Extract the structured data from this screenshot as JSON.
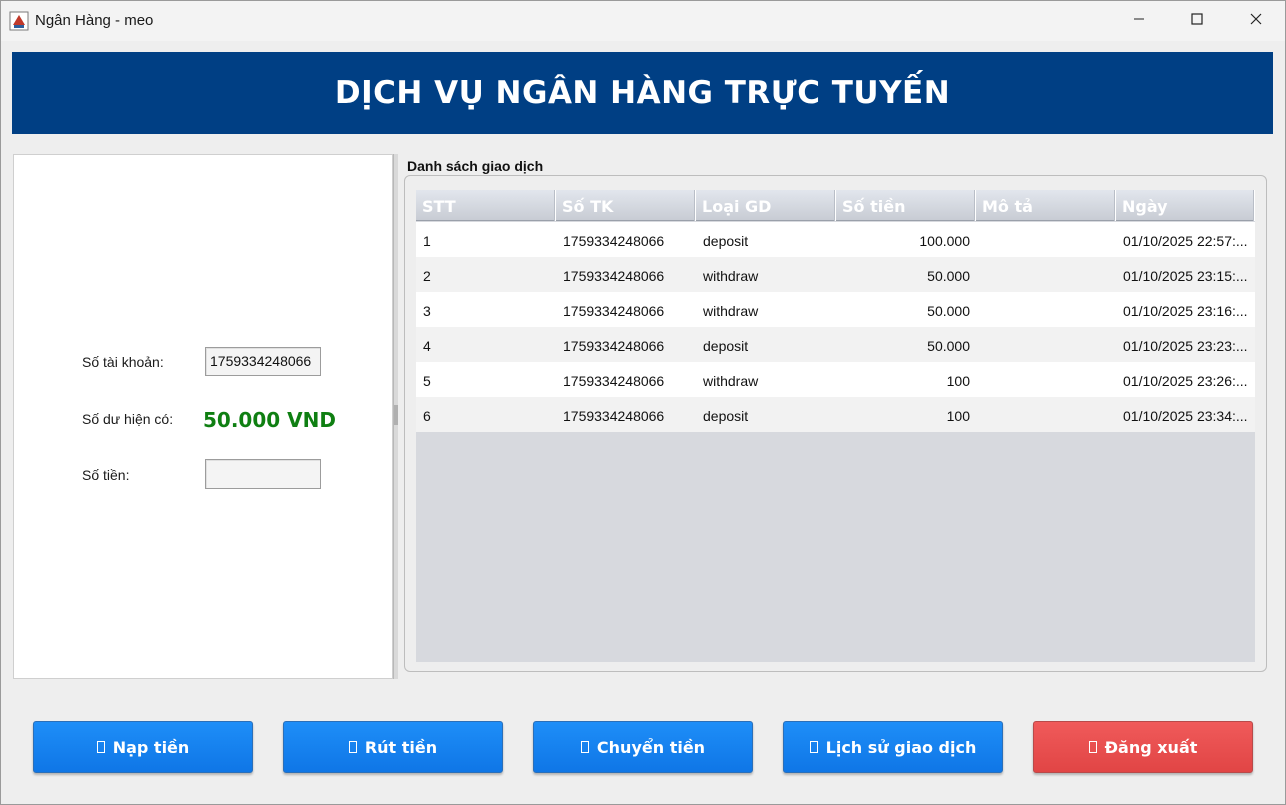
{
  "window": {
    "title": "Ngân Hàng - meo",
    "app_icon": "java-cup-icon",
    "controls": [
      "minimize-icon",
      "maximize-icon",
      "close-icon"
    ]
  },
  "header": {
    "title": "DỊCH VỤ NGÂN HÀNG TRỰC TUYẾN",
    "background": "#003f84"
  },
  "account_panel": {
    "account_label": "Số tài khoản:",
    "account_value": "1759334248066",
    "balance_label": "Số dư hiện có:",
    "balance_value": "50.000 VND",
    "balance_color": "#0f7f12",
    "amount_label": "Số tiền:",
    "amount_value": ""
  },
  "transactions": {
    "title": "Danh sách giao dịch",
    "columns": [
      "STT",
      "Số TK",
      "Loại GD",
      "Số tiền",
      "Mô tả",
      "Ngày"
    ],
    "rows": [
      [
        "1",
        "1759334248066",
        "deposit",
        "100.000",
        "",
        "01/10/2025 22:57:..."
      ],
      [
        "2",
        "1759334248066",
        "withdraw",
        "50.000",
        "",
        "01/10/2025 23:15:..."
      ],
      [
        "3",
        "1759334248066",
        "withdraw",
        "50.000",
        "",
        "01/10/2025 23:16:..."
      ],
      [
        "4",
        "1759334248066",
        "deposit",
        "50.000",
        "",
        "01/10/2025 23:23:..."
      ],
      [
        "5",
        "1759334248066",
        "withdraw",
        "100",
        "",
        "01/10/2025 23:26:..."
      ],
      [
        "6",
        "1759334248066",
        "deposit",
        "100",
        "",
        "01/10/2025 23:34:..."
      ]
    ]
  },
  "actions": {
    "deposit": "Nạp tiền",
    "withdraw": "Rút tiền",
    "transfer": "Chuyển tiền",
    "history": "Lịch sử giao dịch",
    "logout": "Đăng xuất",
    "primary_color": "#1583ef",
    "danger_color": "#e84f4f"
  }
}
